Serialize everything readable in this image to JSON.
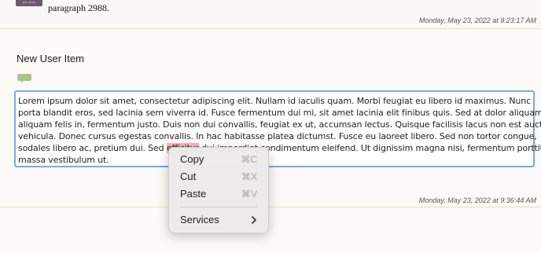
{
  "previous_item": {
    "thumbnail_text": "John Phobe",
    "paragraph": "paragraph 2988.",
    "timestamp": "Monday, May 23, 2022 at 9:23:17 AM"
  },
  "item": {
    "title": "New User Item",
    "text_lines": [
      "Lorem ipsum dolor sit amet, consectetur adipiscing elit. Nullam id iaculis quam. Morbi feugiat eu libero id maximus. Nunc",
      "porta blandit eros, sed lacinia sem viverra id. Fusce fermentum dui mi, sit amet lacinia elit finibus quis. Sed at dolor aliquam,",
      "aliquam felis in, fermentum justo. Duis non dui convallis, feugiat ex ut, accumsan lectus. Quisque facilisis lacus non est auctor",
      "vehicula. Donec cursus egestas convallis. In hac habitasse platea dictumst. Fusce eu laoreet libero. Sed non tortor congue,"
    ],
    "line5_before": "sodales libero ac, pretium dui. Sed ",
    "line5_selected": "efficitur",
    "line5_after": " dui imperdiet condimentum eleifend. Ut dignissim magna nisi, fermentum porttitor",
    "line6": "massa vestibulum ut.",
    "timestamp": "Monday, May 23, 2022 at 9:36:44 AM"
  },
  "context_menu": {
    "items": [
      {
        "label": "Copy",
        "shortcut": "⌘C"
      },
      {
        "label": "Cut",
        "shortcut": "⌘X"
      },
      {
        "label": "Paste",
        "shortcut": "⌘V"
      }
    ],
    "services_label": "Services"
  },
  "colors": {
    "accent_border": "#7aa6ea",
    "selection": "#f0b6b6",
    "comment_icon": "#a7c48a"
  }
}
